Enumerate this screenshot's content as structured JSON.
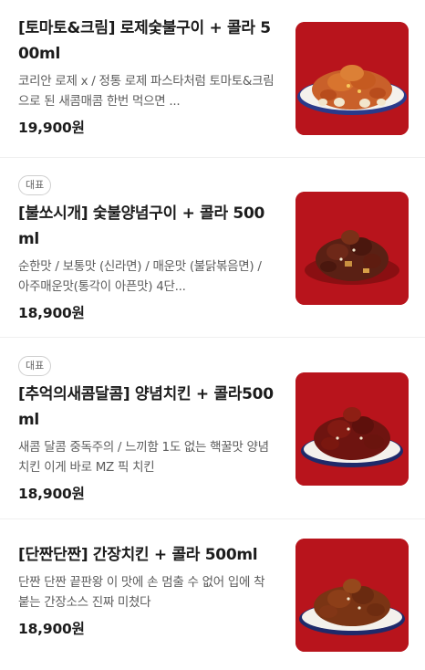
{
  "items": [
    {
      "badge": "",
      "title": "[토마토&크림] 로제숯불구이 + 콜라 500ml",
      "description": "코리안 로제 x / 정통 로제 파스타처럼 토마토&크림으로 된 새콤매콤 한번 먹으면 ...",
      "price": "19,900원",
      "image": "chicken-rose-photo",
      "food_color": "#c9602a"
    },
    {
      "badge": "대표",
      "title": "[불쏘시개] 숯불양념구이 + 콜라 500ml",
      "description": "순한맛 / 보통맛 (신라면) / 매운맛 (불닭볶음면) / 아주매운맛(통각이 아픈맛) 4단...",
      "price": "18,900원",
      "image": "chicken-spicy-photo",
      "food_color": "#5a2014"
    },
    {
      "badge": "대표",
      "title": "[추억의새콤달콤] 양념치킨 + 콜라500ml",
      "description": "새콤 달콤 중독주의 / 느끼함 1도 없는 핵꿀맛 양념치킨 이게 바로 MZ 픽 치킨",
      "price": "18,900원",
      "image": "chicken-yangnyeom-photo",
      "food_color": "#6e1410"
    },
    {
      "badge": "",
      "title": "[단짠단짠] 간장치킨 + 콜라 500ml",
      "description": "단짠 단짠 끝판왕 이 맛에 손 멈출 수 없어 입에 착붙는 간장소스 진짜 미쳤다",
      "price": "18,900원",
      "image": "chicken-soy-photo",
      "food_color": "#7a3414"
    }
  ]
}
